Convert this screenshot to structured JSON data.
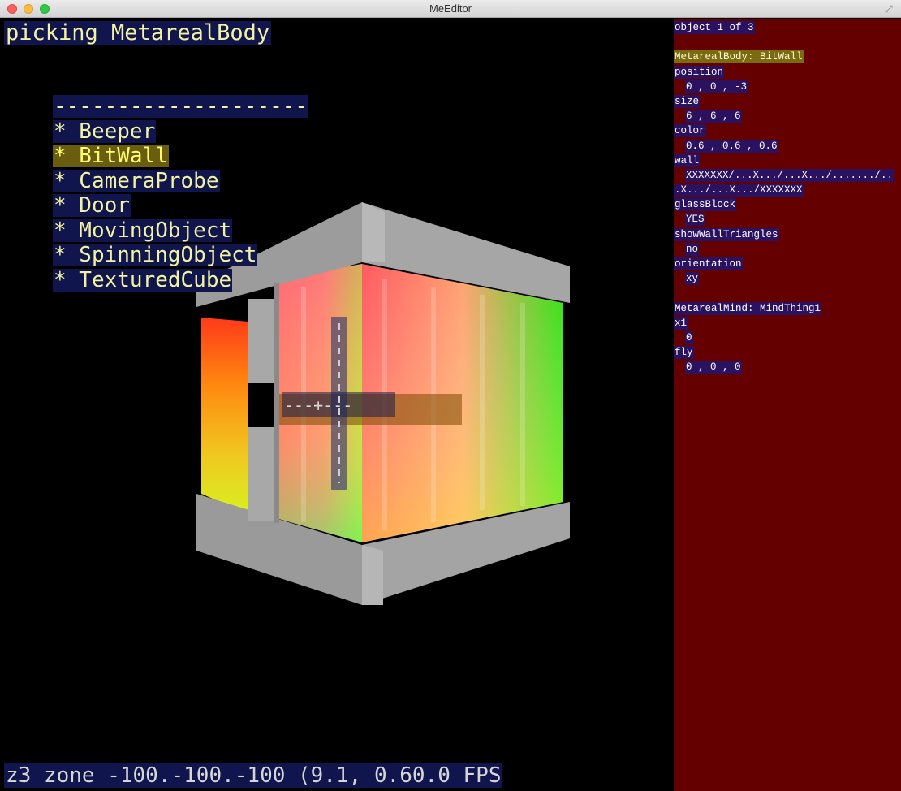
{
  "window": {
    "title": "MeEditor"
  },
  "viewport": {
    "mode_label": "picking MetarealBody",
    "menu": {
      "separator": "--------------------",
      "items": [
        {
          "label": "* Beeper",
          "selected": false
        },
        {
          "label": "* BitWall",
          "selected": true
        },
        {
          "label": "* CameraProbe",
          "selected": false
        },
        {
          "label": "* Door",
          "selected": false
        },
        {
          "label": "* MovingObject",
          "selected": false
        },
        {
          "label": "* SpinningObject",
          "selected": false
        },
        {
          "label": "* TexturedCube",
          "selected": false
        }
      ]
    },
    "crosshair_text": "---+---",
    "status": "z3 zone -100.-100.-100 (9.1, 0.60.0 FPS"
  },
  "inspector": {
    "header": "object 1 of 3",
    "body_title": "MetarealBody: BitWall",
    "fields": [
      {
        "name": "position",
        "value": "0 , 0 , -3"
      },
      {
        "name": "size",
        "value": "6 , 6 , 6"
      },
      {
        "name": "color",
        "value": "0.6 , 0.6 , 0.6"
      },
      {
        "name": "wall",
        "value": "XXXXXXX/...X.../...X.../......./..",
        "value2": ".X.../...X.../XXXXXXX"
      },
      {
        "name": "glassBlock",
        "value": "YES"
      },
      {
        "name": "showWallTriangles",
        "value": "no"
      },
      {
        "name": "orientation",
        "value": "xy"
      }
    ],
    "mind_title": "MetarealMind: MindThing1",
    "mind_fields": [
      {
        "name": "x1",
        "value": "0"
      },
      {
        "name": "fly",
        "value": "0 , 0 , 0"
      }
    ]
  },
  "colors": {
    "panel_bg": "#640000",
    "label_bg": "#10154d",
    "label_text": "#f2f2a0",
    "selection_bg": "#6b5d10",
    "frame_gray": "#a0a0a0"
  }
}
